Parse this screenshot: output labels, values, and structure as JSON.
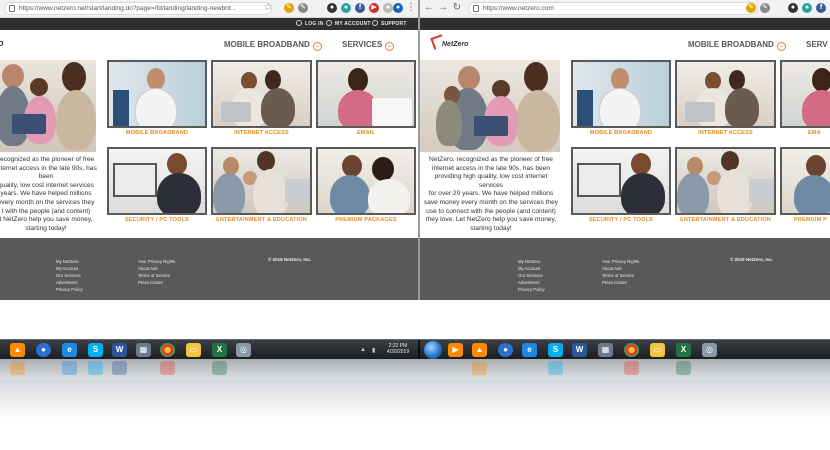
{
  "left": {
    "url": "https://www.netzero.net/start/landing.do?page=/fd/landing/landing-newbrit...",
    "topnav": {
      "login": "LOG IN",
      "account": "MY ACCOUNT",
      "support": "SUPPORT"
    },
    "menu": {
      "broadband": "MOBILE BROADBAND",
      "services": "SERVICES"
    },
    "logo_partial": "o",
    "cards": [
      {
        "label": "MOBILE BROADBAND"
      },
      {
        "label": "INTERNET ACCESS"
      },
      {
        "label": "EMAIL"
      },
      {
        "label": "SECURITY / PC TOOLS"
      },
      {
        "label": "ENTERTAINMENT & EDUCATION"
      },
      {
        "label": "PREMIUM PACKAGES"
      }
    ],
    "intro_lines": [
      "recognized as the pioneer of free",
      "internet access in the late 90s, has been",
      "quality, low cost internet services",
      "years. We have helped millions",
      "every month on the services they",
      "t with the people (and content)",
      "t NetZero help you save money,",
      "starting today!"
    ],
    "footer": {
      "col1": [
        "My NetZero",
        "My Account",
        "Our Services",
        "Advertisers",
        "Privacy Policy"
      ],
      "col2": [
        "Your Privacy Rights",
        "About Ads",
        "Terms of Service",
        "Press Center"
      ],
      "copyright": "© 2019 NetZero, Inc."
    }
  },
  "right": {
    "url": "https://www.netzero.com",
    "topnav": {
      "login": "LOG IN",
      "account": "MY ACCOUNT",
      "support": "SUPPORT"
    },
    "menu": {
      "broadband": "MOBILE BROADBAND",
      "services": "SERV"
    },
    "logo": "NetZero",
    "cards": [
      {
        "label": "MOBILE BROADBAND"
      },
      {
        "label": "INTERNET ACCESS"
      },
      {
        "label": "EMA"
      },
      {
        "label": "SECURITY / PC TOOLS"
      },
      {
        "label": "ENTERTAINMENT & EDUCATION"
      },
      {
        "label": "PREMIUM P"
      }
    ],
    "intro_lines": [
      "NetZero, recognized as the pioneer of free",
      "internet access in the late 90s, has been",
      "providing high quality, low cost internet services",
      "for over 20 years. We have helped millions",
      "save money every month on the services they",
      "use to connect with the people (and content)",
      "they love. Let NetZero help you save money,",
      "starting today!"
    ],
    "footer": {
      "col1": [
        "My NetZero",
        "My Account",
        "Our Services",
        "Advertisers",
        "Privacy Policy"
      ],
      "col2": [
        "Your Privacy Rights",
        "About Ads",
        "Terms of Service",
        "Press Center"
      ],
      "copyright": "© 2019 NetZero, Inc."
    }
  },
  "taskbar": {
    "time": "2:22 PM",
    "date": "4/30/2019"
  },
  "colors": {
    "accent_orange": "#e58a1f",
    "topbar": "#2f2f2f",
    "footer": "#595959"
  }
}
